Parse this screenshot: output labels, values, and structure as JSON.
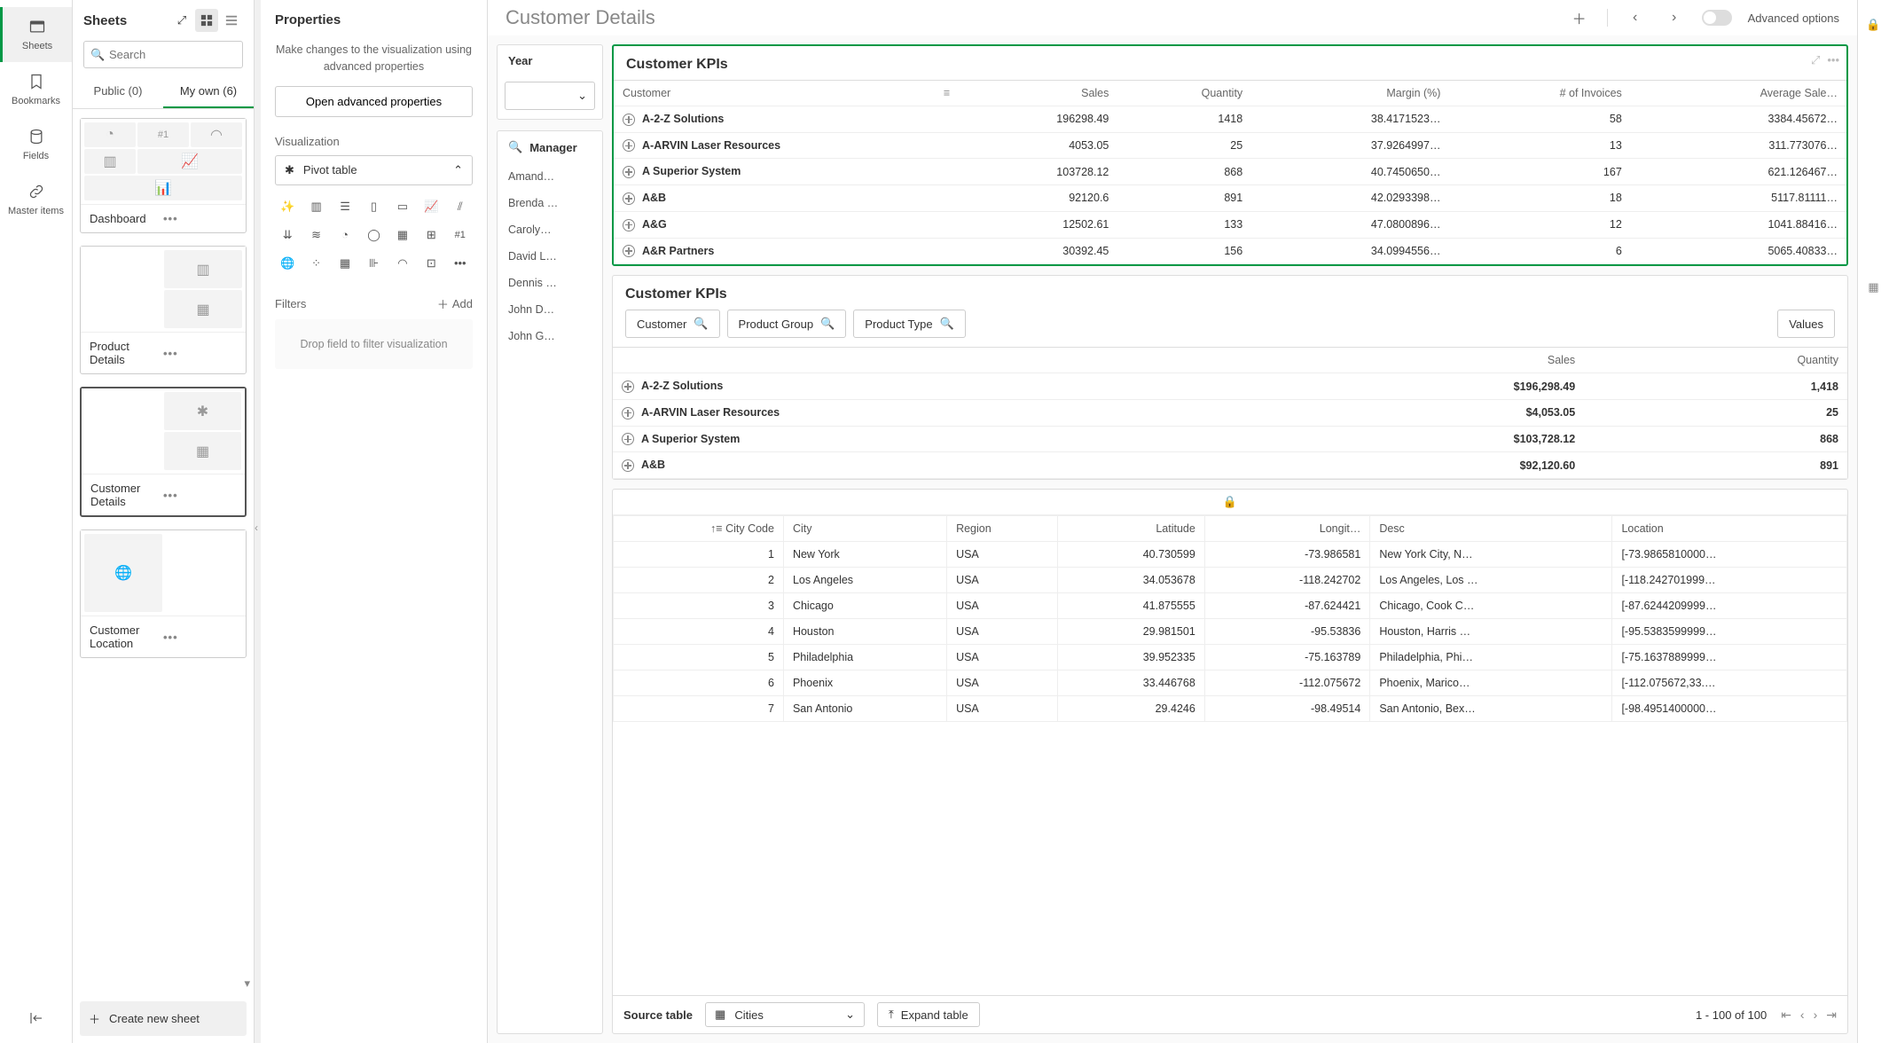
{
  "rail": {
    "sheets": "Sheets",
    "bookmarks": "Bookmarks",
    "fields": "Fields",
    "master": "Master items"
  },
  "sheetsPanel": {
    "title": "Sheets",
    "searchPlaceholder": "Search",
    "tabs": {
      "public": "Public (0)",
      "myown": "My own (6)"
    },
    "cards": {
      "dashboard": "Dashboard",
      "productDetails": "Product Details",
      "customerDetails": "Customer Details",
      "customerLocation": "Customer Location"
    },
    "createNew": "Create new sheet"
  },
  "props": {
    "title": "Properties",
    "note": "Make changes to the visualization using advanced properties",
    "openAdv": "Open advanced properties",
    "vizLabel": "Visualization",
    "vizType": "Pivot table",
    "filtersLabel": "Filters",
    "add": "Add",
    "filterDrop": "Drop field to filter visualization"
  },
  "canvas": {
    "title": "Customer Details",
    "advOptions": "Advanced options",
    "year": "Year",
    "manager": "Manager",
    "managers": [
      "Amand…",
      "Brenda …",
      "Caroly…",
      "David L…",
      "Dennis …",
      "John D…",
      "John G…"
    ]
  },
  "kpi1": {
    "title": "Customer KPIs",
    "cols": [
      "Customer",
      "Sales",
      "Quantity",
      "Margin (%)",
      "# of Invoices",
      "Average Sale…"
    ],
    "rows": [
      [
        "A-2-Z Solutions",
        "196298.49",
        "1418",
        "38.4171523…",
        "58",
        "3384.45672…"
      ],
      [
        "A-ARVIN Laser Resources",
        "4053.05",
        "25",
        "37.9264997…",
        "13",
        "311.773076…"
      ],
      [
        "A Superior System",
        "103728.12",
        "868",
        "40.7450650…",
        "167",
        "621.126467…"
      ],
      [
        "A&B",
        "92120.6",
        "891",
        "42.0293398…",
        "18",
        "5117.81111…"
      ],
      [
        "A&G",
        "12502.61",
        "133",
        "47.0800896…",
        "12",
        "1041.88416…"
      ],
      [
        "A&R Partners",
        "30392.45",
        "156",
        "34.0994556…",
        "6",
        "5065.40833…"
      ]
    ]
  },
  "kpi2": {
    "title": "Customer KPIs",
    "chips": {
      "customer": "Customer",
      "productGroup": "Product Group",
      "productType": "Product Type",
      "values": "Values"
    },
    "cols": [
      "Sales",
      "Quantity"
    ],
    "rows": [
      [
        "A-2-Z Solutions",
        "$196,298.49",
        "1,418"
      ],
      [
        "A-ARVIN Laser Resources",
        "$4,053.05",
        "25"
      ],
      [
        "A Superior System",
        "$103,728.12",
        "868"
      ],
      [
        "A&B",
        "$92,120.60",
        "891"
      ]
    ]
  },
  "dataTable": {
    "cols": [
      "City Code",
      "City",
      "Region",
      "Latitude",
      "Longit…",
      "Desc",
      "Location"
    ],
    "rows": [
      [
        "1",
        "New York",
        "USA",
        "40.730599",
        "-73.986581",
        "New York City, N…",
        "[-73.9865810000…"
      ],
      [
        "2",
        "Los Angeles",
        "USA",
        "34.053678",
        "-118.242702",
        "Los Angeles, Los …",
        "[-118.242701999…"
      ],
      [
        "3",
        "Chicago",
        "USA",
        "41.875555",
        "-87.624421",
        "Chicago, Cook C…",
        "[-87.6244209999…"
      ],
      [
        "4",
        "Houston",
        "USA",
        "29.981501",
        "-95.53836",
        "Houston, Harris …",
        "[-95.5383599999…"
      ],
      [
        "5",
        "Philadelphia",
        "USA",
        "39.952335",
        "-75.163789",
        "Philadelphia, Phi…",
        "[-75.1637889999…"
      ],
      [
        "6",
        "Phoenix",
        "USA",
        "33.446768",
        "-112.075672",
        "Phoenix, Marico…",
        "[-112.075672,33.…"
      ],
      [
        "7",
        "San Antonio",
        "USA",
        "29.4246",
        "-98.49514",
        "San Antonio, Bex…",
        "[-98.4951400000…"
      ]
    ],
    "sourceLabel": "Source table",
    "sourceValue": "Cities",
    "expand": "Expand table",
    "pager": "1 - 100 of 100"
  }
}
